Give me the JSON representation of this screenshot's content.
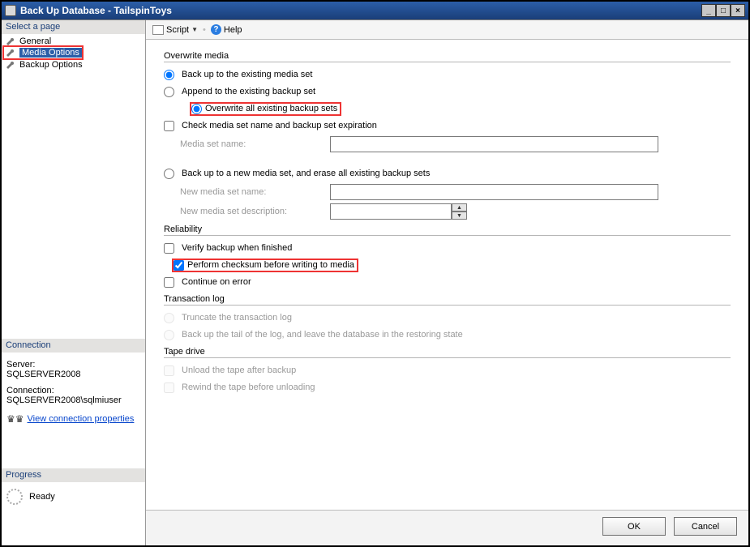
{
  "window": {
    "title": "Back Up Database - TailspinToys"
  },
  "sidebar": {
    "select_page_hdr": "Select a page",
    "items": [
      {
        "label": "General"
      },
      {
        "label": "Media Options"
      },
      {
        "label": "Backup Options"
      }
    ],
    "connection_hdr": "Connection",
    "server_label": "Server:",
    "server_value": "SQLSERVER2008",
    "conn_label": "Connection:",
    "conn_value": "SQLSERVER2008\\sqlmiuser",
    "view_conn_link": "View connection properties",
    "progress_hdr": "Progress",
    "progress_status": "Ready"
  },
  "toolbar": {
    "script_label": "Script",
    "help_label": "Help"
  },
  "overwrite": {
    "group": "Overwrite media",
    "opt_existing": "Back up to the existing media set",
    "sub_append": "Append to the existing backup set",
    "sub_overwrite": "Overwrite all existing backup sets",
    "check_media_name": "Check media set name and backup set expiration",
    "media_set_name_label": "Media set name:",
    "opt_new": "Back up to a new media set, and erase all existing backup sets",
    "new_name_label": "New media set name:",
    "new_desc_label": "New media set description:"
  },
  "reliability": {
    "group": "Reliability",
    "verify": "Verify backup when finished",
    "checksum": "Perform checksum before writing to media",
    "continue": "Continue on error"
  },
  "tlog": {
    "group": "Transaction log",
    "truncate": "Truncate the transaction log",
    "tail": "Back up the tail of the log, and leave the database in the restoring state"
  },
  "tape": {
    "group": "Tape drive",
    "unload": "Unload the tape after backup",
    "rewind": "Rewind the tape before unloading"
  },
  "buttons": {
    "ok": "OK",
    "cancel": "Cancel"
  }
}
